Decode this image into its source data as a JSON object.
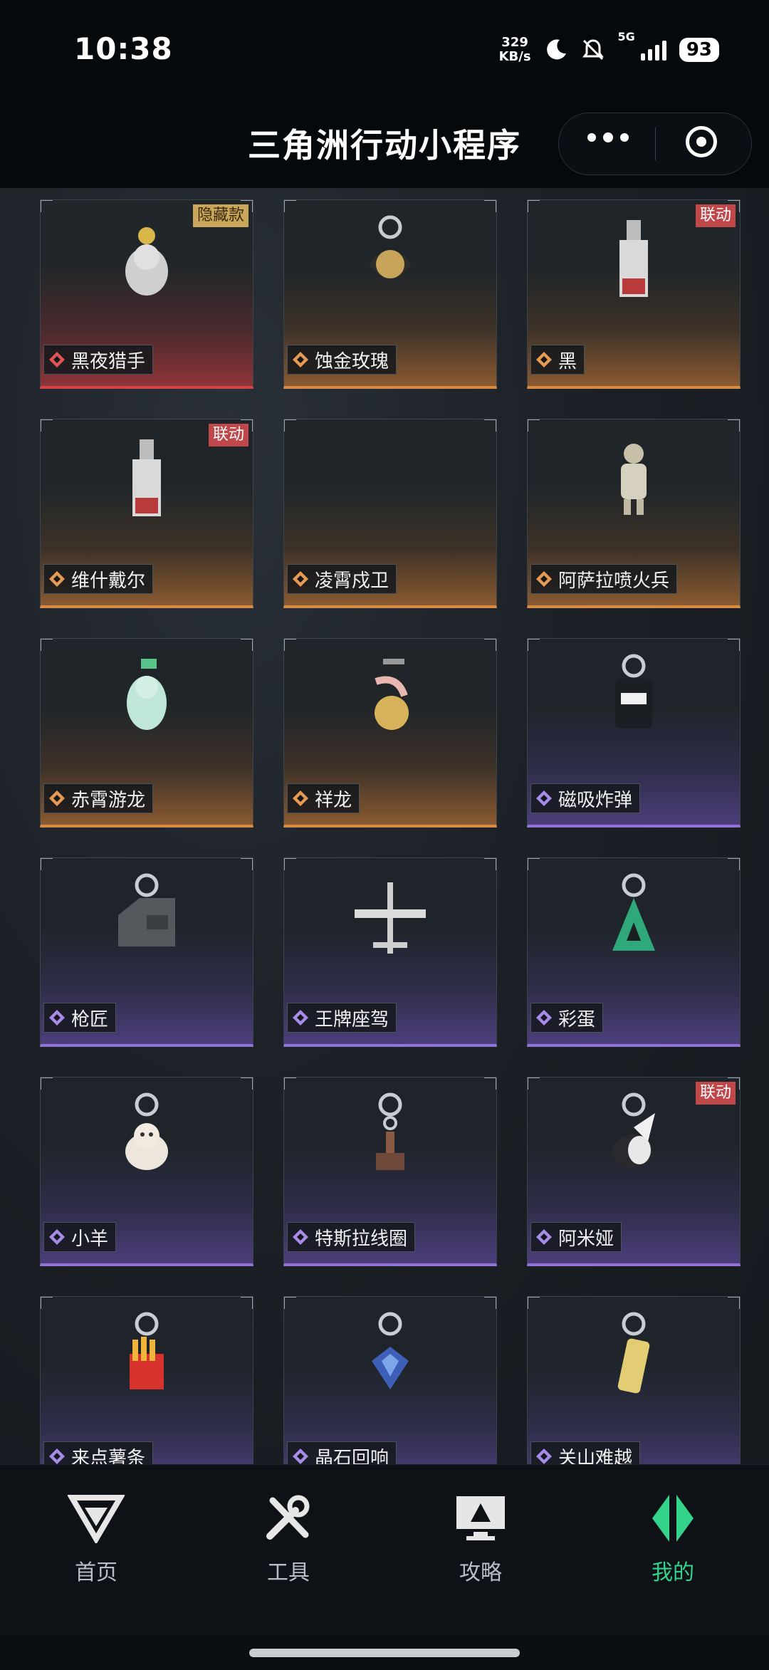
{
  "status": {
    "time": "10:38",
    "speed_top": "329",
    "speed_unit": "KB/s",
    "network": "5G",
    "battery": "93"
  },
  "header": {
    "title": "三角洲行动小程序"
  },
  "colors": {
    "accent_green": "#34d38a",
    "red": "#d44444",
    "gold": "#d78a43",
    "purple": "#9274d6"
  },
  "items": [
    {
      "name": "黑夜猎手",
      "rarity": "red",
      "badge": "隐藏款",
      "badge_type": "hidden",
      "icon": "wolf-figure-charm"
    },
    {
      "name": "蚀金玫瑰",
      "rarity": "gold",
      "badge": "",
      "badge_type": "",
      "icon": "rose-charm"
    },
    {
      "name": "黑",
      "rarity": "gold",
      "badge": "联动",
      "badge_type": "collab",
      "icon": "tag-card-charm"
    },
    {
      "name": "维什戴尔",
      "rarity": "gold",
      "badge": "联动",
      "badge_type": "collab",
      "icon": "tag-card-charm"
    },
    {
      "name": "凌霄戍卫",
      "rarity": "gold",
      "badge": "",
      "badge_type": "",
      "icon": "empty-charm"
    },
    {
      "name": "阿萨拉喷火兵",
      "rarity": "gold",
      "badge": "",
      "badge_type": "",
      "icon": "soldier-figure-charm"
    },
    {
      "name": "赤霄游龙",
      "rarity": "gold",
      "badge": "",
      "badge_type": "",
      "icon": "dragon-figure-charm"
    },
    {
      "name": "祥龙",
      "rarity": "gold",
      "badge": "",
      "badge_type": "",
      "icon": "dragon-ball-charm"
    },
    {
      "name": "磁吸炸弹",
      "rarity": "purple",
      "badge": "",
      "badge_type": "",
      "icon": "bomb-charm"
    },
    {
      "name": "枪匠",
      "rarity": "purple",
      "badge": "",
      "badge_type": "",
      "icon": "case-charm"
    },
    {
      "name": "王牌座驾",
      "rarity": "purple",
      "badge": "",
      "badge_type": "",
      "icon": "plane-charm"
    },
    {
      "name": "彩蛋",
      "rarity": "purple",
      "badge": "",
      "badge_type": "",
      "icon": "logo-charm"
    },
    {
      "name": "小羊",
      "rarity": "purple",
      "badge": "",
      "badge_type": "",
      "icon": "sheep-charm"
    },
    {
      "name": "特斯拉线圈",
      "rarity": "purple",
      "badge": "",
      "badge_type": "",
      "icon": "coil-charm"
    },
    {
      "name": "阿米娅",
      "rarity": "purple",
      "badge": "联动",
      "badge_type": "collab",
      "icon": "bunny-charm"
    },
    {
      "name": "来点薯条",
      "rarity": "purple",
      "badge": "",
      "badge_type": "",
      "icon": "fries-charm"
    },
    {
      "name": "晶石回响",
      "rarity": "purple",
      "badge": "",
      "badge_type": "",
      "icon": "crystal-charm"
    },
    {
      "name": "关山难越",
      "rarity": "purple",
      "badge": "",
      "badge_type": "",
      "icon": "stick-charm"
    }
  ],
  "nav": [
    {
      "label": "首页",
      "icon": "home-logo-icon"
    },
    {
      "label": "工具",
      "icon": "tools-icon"
    },
    {
      "label": "攻略",
      "icon": "guide-monitor-icon"
    },
    {
      "label": "我的",
      "icon": "profile-logo-icon",
      "active": true
    }
  ]
}
